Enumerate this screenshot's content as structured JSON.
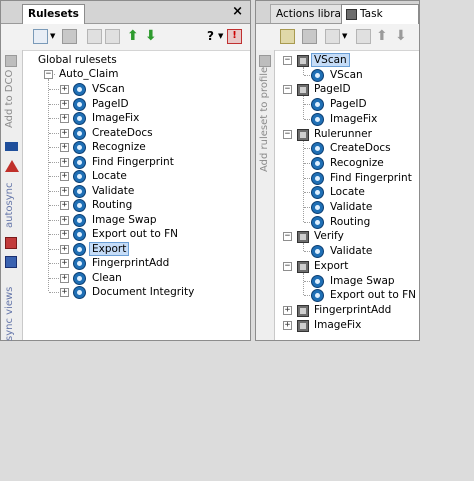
{
  "left_panel": {
    "tab_label": "Rulesets",
    "close_label": "×",
    "help_label": "?",
    "vertical": {
      "add_to_dco": "Add to DCO",
      "autosync": "autosync",
      "sync_views": "sync views"
    },
    "tree": {
      "root": "Global rulesets",
      "group": "Auto_Claim",
      "items": [
        "VScan",
        "PageID",
        "ImageFix",
        "CreateDocs",
        "Recognize",
        "Find Fingerprint",
        "Locate",
        "Validate",
        "Routing",
        "Image Swap",
        "Export out to FN",
        "Export",
        "FingerprintAdd",
        "Clean",
        "Document Integrity"
      ],
      "selected": "Export"
    }
  },
  "right_panel": {
    "tabs": [
      "Actions library",
      "Task profiles"
    ],
    "vertical": {
      "add_ruleset_to_profile": "Add ruleset to profile"
    },
    "profiles": [
      {
        "name": "VScan",
        "selected": true,
        "children": [
          "VScan"
        ]
      },
      {
        "name": "PageID",
        "children": [
          "PageID",
          "ImageFix"
        ]
      },
      {
        "name": "Rulerunner",
        "children": [
          "CreateDocs",
          "Recognize",
          "Find Fingerprint",
          "Locate",
          "Validate",
          "Routing"
        ]
      },
      {
        "name": "Verify",
        "children": [
          "Validate"
        ]
      },
      {
        "name": "Export",
        "children": [
          "Image Swap",
          "Export out to FN"
        ]
      },
      {
        "name": "FingerprintAdd",
        "children": []
      },
      {
        "name": "ImageFix",
        "children": []
      }
    ]
  },
  "colors": {
    "selection": "#c5dcf7",
    "ruleset_icon": "#1f6fb5",
    "green_arrow": "#2e9b2e"
  }
}
